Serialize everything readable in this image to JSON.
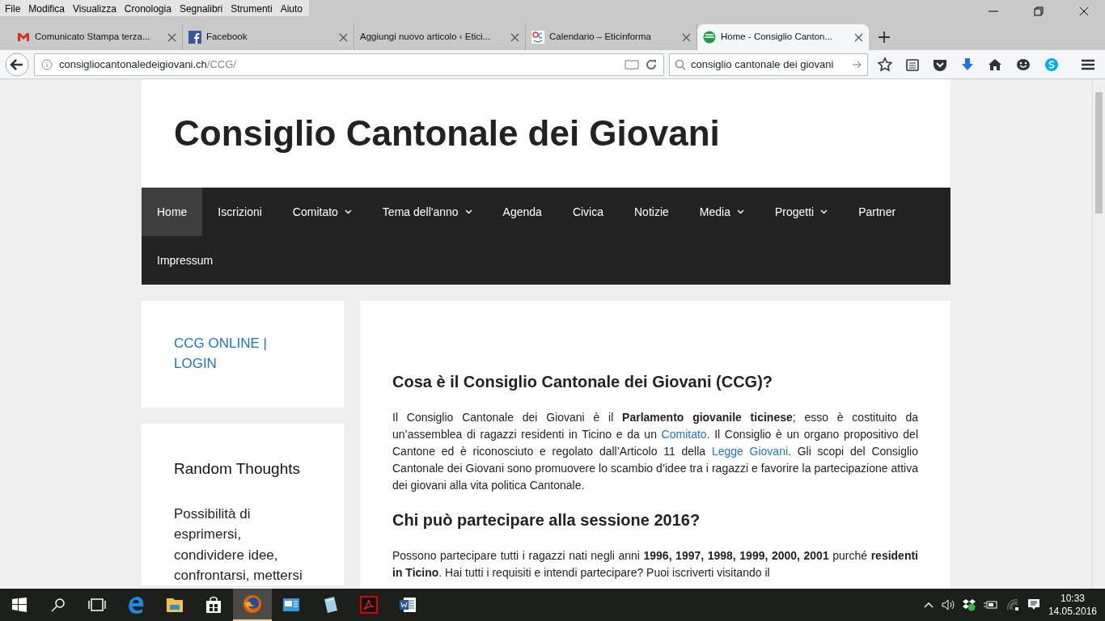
{
  "menu_bar": [
    "File",
    "Modifica",
    "Visualizza",
    "Cronologia",
    "Segnalibri",
    "Strumenti",
    "Aiuto"
  ],
  "tabs": [
    {
      "title": "Comunicato Stampa terza...",
      "selected": false
    },
    {
      "title": "Facebook",
      "selected": false
    },
    {
      "title": "Aggiungi nuovo articolo ‹ Etici...",
      "selected": false
    },
    {
      "title": "Calendario – Eticinforma",
      "selected": false
    },
    {
      "title": "Home - Consiglio Canton...",
      "selected": true
    }
  ],
  "address_bar": {
    "domain": "consigliocantonaledeigiovani.ch",
    "path": "/CCG/"
  },
  "search_field": {
    "value": "consiglio cantonale dei giovani"
  },
  "site": {
    "title": "Consiglio Cantonale dei Giovani",
    "nav": [
      {
        "label": "Home",
        "selected": true,
        "dropdown": false
      },
      {
        "label": "Iscrizioni",
        "selected": false,
        "dropdown": false
      },
      {
        "label": "Comitato",
        "selected": false,
        "dropdown": true
      },
      {
        "label": "Tema dell'anno",
        "selected": false,
        "dropdown": true
      },
      {
        "label": "Agenda",
        "selected": false,
        "dropdown": false
      },
      {
        "label": "Civica",
        "selected": false,
        "dropdown": false
      },
      {
        "label": "Notizie",
        "selected": false,
        "dropdown": false
      },
      {
        "label": "Media",
        "selected": false,
        "dropdown": true
      },
      {
        "label": "Progetti",
        "selected": false,
        "dropdown": true
      },
      {
        "label": "Partner",
        "selected": false,
        "dropdown": false
      },
      {
        "label": "Impressum",
        "selected": false,
        "dropdown": false
      }
    ],
    "login_link": "CCG ONLINE | LOGIN",
    "widget": {
      "title": "Random Thoughts",
      "text": "Possibilità di esprimersi, condividere idee, confrontarsi, mettersi"
    },
    "article": [
      {
        "heading": "Cosa è il Consiglio Cantonale dei Giovani (CCG)?",
        "segments": [
          {
            "kind": "text",
            "text": "Il Consiglio Cantonale dei Giovani è il **Parlamento giovanile ticinese**; esso è costituito da un’assemblea di ragazzi residenti in Ticino e da un "
          },
          {
            "kind": "link",
            "text": "Comitato"
          },
          {
            "kind": "text",
            "text": ". Il Consiglio è un organo propositivo del Cantone ed è riconosciuto e regolato dall’Articolo 11 della "
          },
          {
            "kind": "link",
            "text": "Legge Giovani"
          },
          {
            "kind": "text",
            "text": ". Gli scopi del Consiglio Cantonale dei Giovani sono promuovere lo scambio d’idee tra i ragazzi e favorire la partecipazione attiva dei giovani alla vita politica Cantonale."
          }
        ]
      },
      {
        "heading": "Chi può partecipare alla sessione 2016?",
        "segments": [
          {
            "kind": "text",
            "text": "Possono partecipare tutti i ragazzi nati negli anni **1996, 1997, 1998, 1999, 2000, 2001** purché **residenti in Ticino**. Hai tutti i requisiti e intendi partecipare? Puoi iscriverti visitando il"
          }
        ]
      }
    ]
  },
  "taskbar": {
    "apps": [
      {
        "kind": "edge",
        "active": false
      },
      {
        "kind": "folder",
        "active": false
      },
      {
        "kind": "store",
        "active": false
      },
      {
        "kind": "firefox",
        "active": true
      },
      {
        "kind": "presentation",
        "active": false
      },
      {
        "kind": "notepad",
        "active": false
      },
      {
        "kind": "pdf",
        "active": false
      },
      {
        "kind": "word",
        "active": false
      }
    ],
    "time": "10:33",
    "date": "14.05.2016"
  }
}
